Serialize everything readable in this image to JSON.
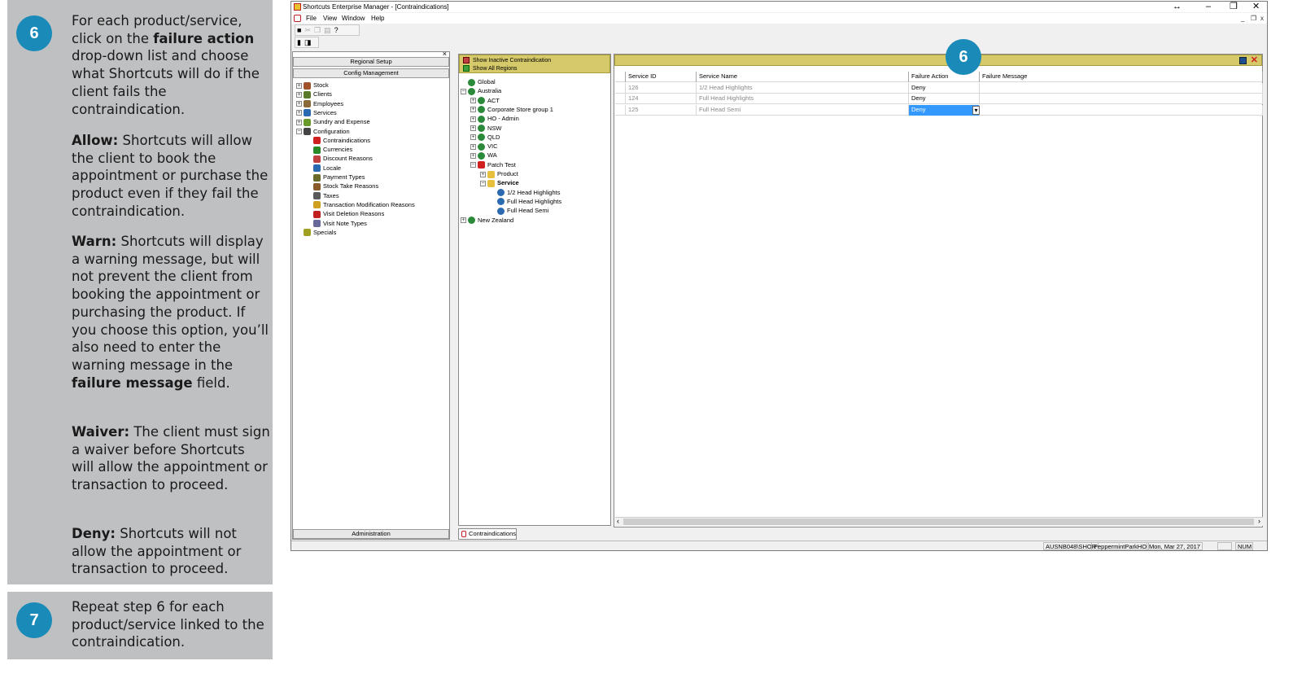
{
  "instructions": {
    "step6": {
      "number": "6",
      "intro_pre": "For each product/service, click on the ",
      "intro_bold": "failure action",
      "intro_post": " drop-down list and choose what Shortcuts will do if the client fails the contraindication.",
      "allow_label": "Allow:",
      "allow_text": " Shortcuts will allow the client to book the appointment or purchase the product even if they fail the contraindication.",
      "warn_label": "Warn:",
      "warn_text": " Shortcuts will display a warning message, but will not prevent the client from booking the appointment or purchasing the product. If you choose this option, you’ll also need to enter the warning message in the ",
      "warn_bold": "failure message",
      "warn_end": " field.",
      "waiver_label": "Waiver:",
      "waiver_text": " The client must sign a waiver before Shortcuts will allow the appointment or transaction to proceed.",
      "deny_label": "Deny:",
      "deny_text": " Shortcuts will not allow the appointment or transaction to proceed."
    },
    "step7": {
      "number": "7",
      "text": "Repeat step 6 for each product/service linked to the contraindication."
    }
  },
  "window": {
    "title": "Shortcuts Enterprise Manager - [Contraindications]",
    "menu": [
      "File",
      "View",
      "Window",
      "Help"
    ],
    "controls": {
      "resize": "↔",
      "minimize": "–",
      "restore": "❐",
      "close": "✕"
    },
    "mdi_controls": [
      "_",
      "❐",
      "x"
    ]
  },
  "left_pane": {
    "close": "×",
    "regional_setup": "Regional Setup",
    "config_management": "Config Management",
    "administration": "Administration",
    "tree": [
      {
        "label": "Stock",
        "exp": "+",
        "icon": "stock-icon",
        "color": "#a0522d"
      },
      {
        "label": "Clients",
        "exp": "+",
        "icon": "clients-icon",
        "color": "#5a7a2a"
      },
      {
        "label": "Employees",
        "exp": "+",
        "icon": "employees-icon",
        "color": "#8a6a3a"
      },
      {
        "label": "Services",
        "exp": "+",
        "icon": "services-icon",
        "color": "#2a6ab0"
      },
      {
        "label": "Sundry and Expense",
        "exp": "+",
        "icon": "sundry-icon",
        "color": "#6a9a2a"
      },
      {
        "label": "Configuration",
        "exp": "−",
        "icon": "configuration-icon",
        "color": "#444444"
      },
      {
        "label": "Contraindications",
        "child": true,
        "icon": "contraindications-icon",
        "color": "#d02020"
      },
      {
        "label": "Currencies",
        "child": true,
        "icon": "currencies-icon",
        "color": "#2a8a2a"
      },
      {
        "label": "Discount Reasons",
        "child": true,
        "icon": "discount-icon",
        "color": "#c04040"
      },
      {
        "label": "Locale",
        "child": true,
        "icon": "locale-icon",
        "color": "#2a6ab0"
      },
      {
        "label": "Payment Types",
        "child": true,
        "icon": "payment-icon",
        "color": "#6a6a2a"
      },
      {
        "label": "Stock Take Reasons",
        "child": true,
        "icon": "stocktake-icon",
        "color": "#8a5a2a"
      },
      {
        "label": "Taxes",
        "child": true,
        "icon": "taxes-icon",
        "color": "#5a5a5a"
      },
      {
        "label": "Transaction Modification Reasons",
        "child": true,
        "icon": "transaction-icon",
        "color": "#d0a020"
      },
      {
        "label": "Visit Deletion Reasons",
        "child": true,
        "icon": "visit-deletion-icon",
        "color": "#c02020"
      },
      {
        "label": "Visit Note Types",
        "child": true,
        "icon": "visit-note-icon",
        "color": "#6a6a9a"
      },
      {
        "label": "Specials",
        "exp": "",
        "icon": "specials-icon",
        "color": "#a0a020"
      }
    ]
  },
  "mid_pane": {
    "show_inactive": "Show Inactive Contraindication",
    "show_all_regions": "Show All Regions",
    "tree": [
      {
        "label": "Global",
        "level": 0,
        "exp": "",
        "icon": "globe-icon",
        "color": "#2a8a3a"
      },
      {
        "label": "Australia",
        "level": 0,
        "exp": "−",
        "icon": "globe-icon",
        "color": "#2a8a3a"
      },
      {
        "label": "ACT",
        "level": 1,
        "exp": "+",
        "icon": "globe-icon",
        "color": "#2a8a3a"
      },
      {
        "label": "Corporate Store group 1",
        "level": 1,
        "exp": "+",
        "icon": "globe-icon",
        "color": "#2a8a3a"
      },
      {
        "label": "HO - Admin",
        "level": 1,
        "exp": "+",
        "icon": "globe-icon",
        "color": "#2a8a3a"
      },
      {
        "label": "NSW",
        "level": 1,
        "exp": "+",
        "icon": "globe-icon",
        "color": "#2a8a3a"
      },
      {
        "label": "QLD",
        "level": 1,
        "exp": "+",
        "icon": "globe-icon",
        "color": "#2a8a3a"
      },
      {
        "label": "VIC",
        "level": 1,
        "exp": "+",
        "icon": "globe-icon",
        "color": "#2a8a3a"
      },
      {
        "label": "WA",
        "level": 1,
        "exp": "+",
        "icon": "globe-icon",
        "color": "#2a8a3a"
      },
      {
        "label": "Patch Test",
        "level": 1,
        "exp": "−",
        "icon": "contraindication-icon",
        "color": "#d02020"
      },
      {
        "label": "Product",
        "level": 2,
        "exp": "+",
        "icon": "folder-icon",
        "color": "#e8c040"
      },
      {
        "label": "Service",
        "level": 2,
        "exp": "−",
        "icon": "folder-open-icon",
        "color": "#e8c040",
        "bold": true
      },
      {
        "label": "1/2 Head Highlights",
        "level": 3,
        "exp": "",
        "icon": "service-item-icon",
        "color": "#2a6ab0"
      },
      {
        "label": "Full Head Highlights",
        "level": 3,
        "exp": "",
        "icon": "service-item-icon",
        "color": "#2a6ab0"
      },
      {
        "label": "Full Head Semi",
        "level": 3,
        "exp": "",
        "icon": "service-item-icon",
        "color": "#2a6ab0"
      },
      {
        "label": "New Zealand",
        "level": 0,
        "exp": "+",
        "icon": "globe-icon",
        "color": "#2a8a3a"
      }
    ]
  },
  "grid": {
    "columns": [
      "Service ID",
      "Service Name",
      "Failure Action",
      "Failure Message"
    ],
    "rows": [
      {
        "id": "126",
        "name": "1/2 Head Highlights",
        "action": "Deny",
        "message": ""
      },
      {
        "id": "124",
        "name": "Full Head Highlights",
        "action": "Deny",
        "message": ""
      },
      {
        "id": "125",
        "name": "Full Head Semi",
        "action": "Deny",
        "message": ""
      }
    ],
    "dropdown_arrow": "▾",
    "scroll_left": "‹",
    "scroll_right": "›"
  },
  "callout": "6",
  "bottom_tab": "Contraindications",
  "status": {
    "user": "AUSNB048\\SHOR",
    "location": "PeppermintParkHO",
    "date": "Mon, Mar 27, 2017",
    "num": "NUM"
  },
  "colors": {
    "accent_circle": "#1a8bb9",
    "instruction_bg": "#bfc0c2",
    "header_yellow": "#d5c96a",
    "selection_blue": "#3399ff"
  }
}
